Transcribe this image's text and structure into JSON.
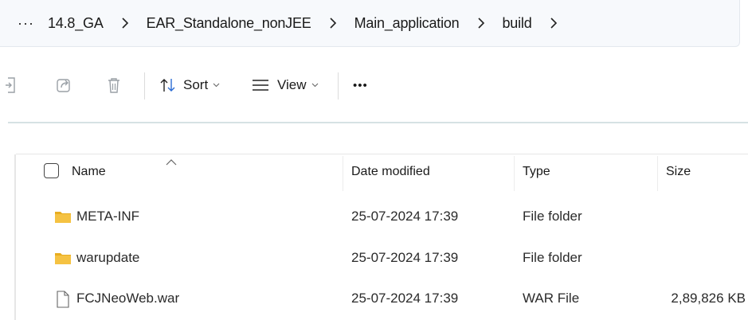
{
  "breadcrumb": {
    "more_label": "···",
    "items": [
      "14.8_GA",
      "EAR_Standalone_nonJEE",
      "Main_application",
      "build"
    ]
  },
  "toolbar": {
    "sort_label": "Sort",
    "view_label": "View",
    "more_label": "•••"
  },
  "columns": {
    "name": "Name",
    "date_modified": "Date modified",
    "type": "Type",
    "size": "Size"
  },
  "files": [
    {
      "name": "META-INF",
      "date": "25-07-2024 17:39",
      "type": "File folder",
      "size": "",
      "icon": "folder-icon"
    },
    {
      "name": "warupdate",
      "date": "25-07-2024 17:39",
      "type": "File folder",
      "size": "",
      "icon": "folder-icon"
    },
    {
      "name": "FCJNeoWeb.war",
      "date": "25-07-2024 17:39",
      "type": "WAR File",
      "size": "2,89,826 KB",
      "icon": "file-icon"
    }
  ],
  "colors": {
    "folder": "#f5c242",
    "folder_dark": "#e8ad20",
    "addressbar_bg": "#f7f9fc",
    "separator": "#d6e2e4"
  }
}
